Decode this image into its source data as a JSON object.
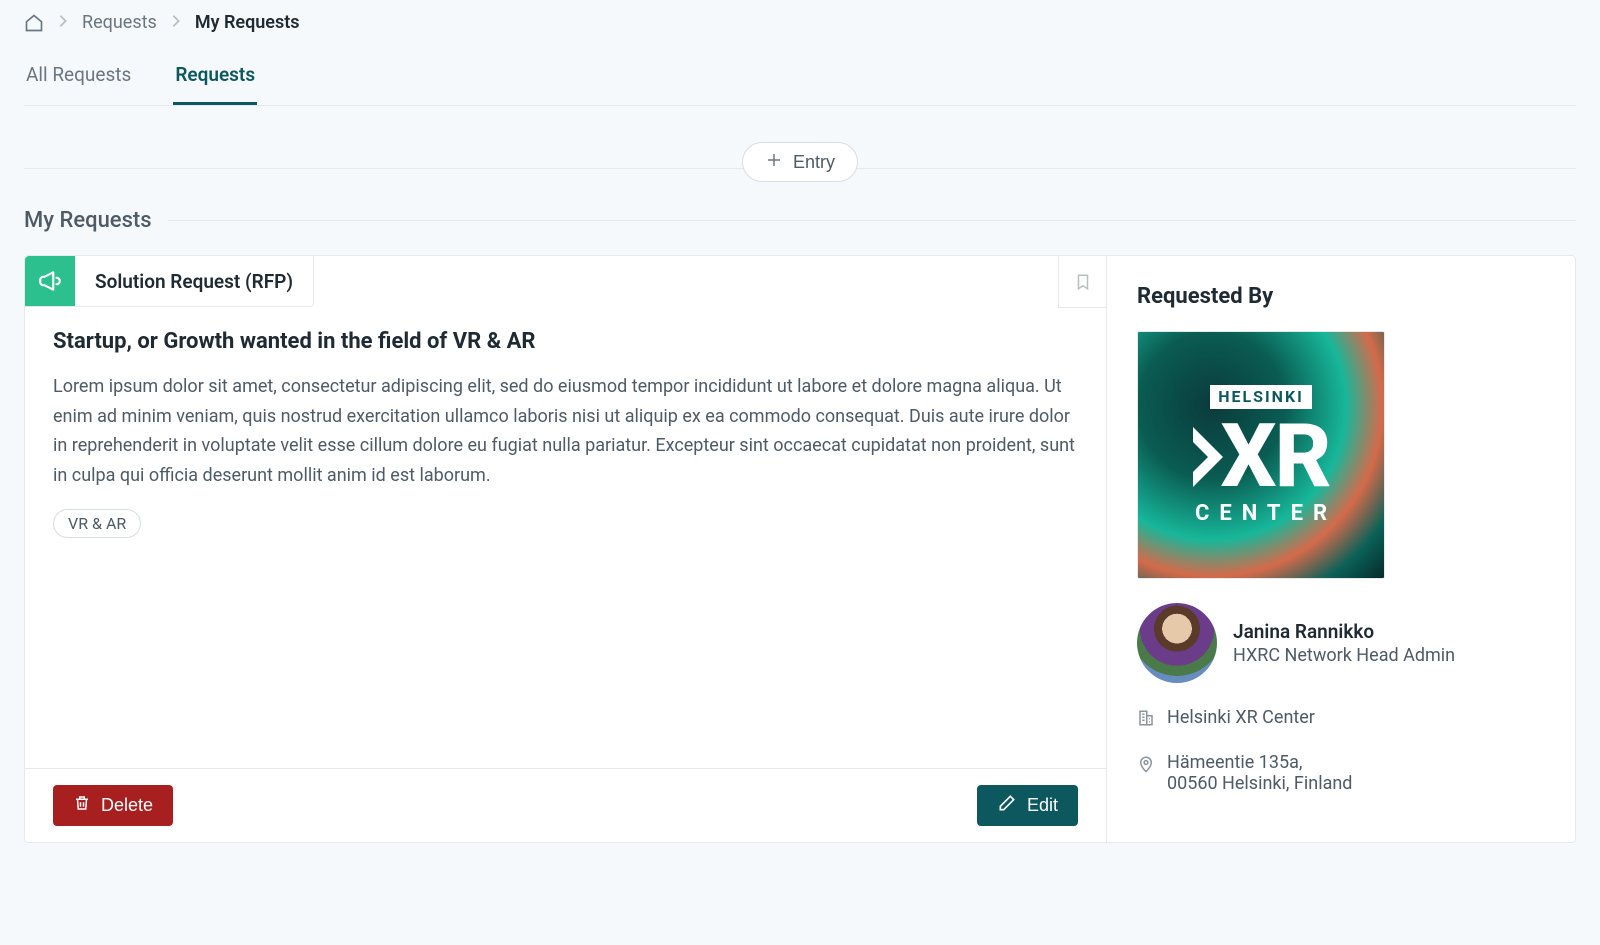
{
  "breadcrumb": {
    "requests": "Requests",
    "my_requests": "My Requests"
  },
  "tabs": {
    "all_requests": "All Requests",
    "requests": "Requests"
  },
  "entry_button": "Entry",
  "section_heading": "My Requests",
  "request": {
    "badge_label": "Solution Request (RFP)",
    "title": "Startup, or Growth wanted in the field of VR & AR",
    "description": "Lorem ipsum dolor sit amet, consectetur adipiscing elit, sed do eiusmod tempor incididunt ut labore et dolore magna aliqua. Ut enim ad minim veniam, quis nostrud exercitation ullamco laboris nisi ut aliquip ex ea commodo consequat. Duis aute irure dolor in reprehenderit in voluptate velit esse cillum dolore eu fugiat nulla pariatur. Excepteur sint occaecat cupidatat non proident, sunt in culpa qui officia deserunt mollit anim id est laborum.",
    "tags": [
      "VR & AR"
    ]
  },
  "actions": {
    "delete": "Delete",
    "edit": "Edit"
  },
  "sidebar": {
    "heading": "Requested By",
    "org_logo": {
      "top": "HELSINKI",
      "mid": "XR",
      "bot": "CENTER"
    },
    "person": {
      "name": "Janina Rannikko",
      "role": "HXRC Network Head Admin"
    },
    "org_name": "Helsinki XR Center",
    "address_line1": "Hämeentie 135a,",
    "address_line2": "00560 Helsinki, Finland"
  }
}
